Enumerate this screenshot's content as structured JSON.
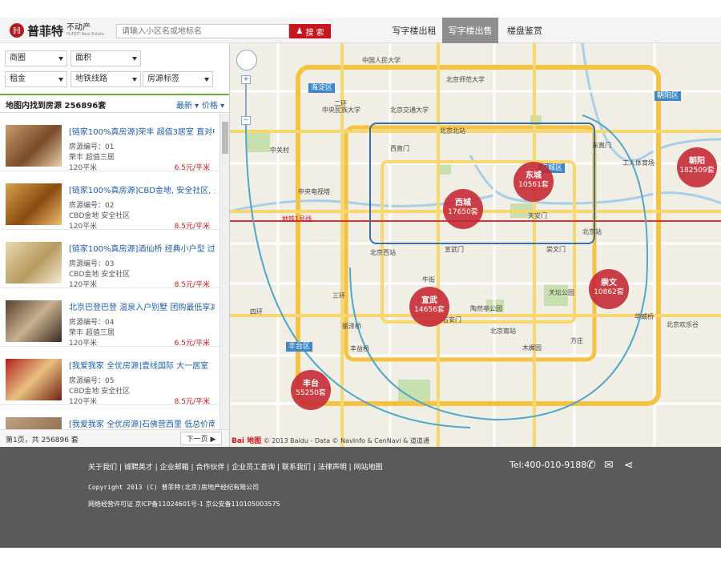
{
  "brand": {
    "name_cn": "普菲特",
    "name_sub": "不动产",
    "name_en": "PUFEIT Real Estate"
  },
  "search": {
    "placeholder": "请输入小区名或地标名",
    "button": "搜 索"
  },
  "nav": {
    "tabs": [
      "写字楼出租",
      "写字楼出售",
      "楼盘鉴赏"
    ],
    "active": "写字楼出售"
  },
  "filters": {
    "row1": [
      "商圈",
      "面积"
    ],
    "row2": [
      "租金",
      "地铁线路",
      "房源标签"
    ]
  },
  "results": {
    "summary": "地图内找到房源 256896套",
    "sort_latest": "最新",
    "sort_price": "价格"
  },
  "listings": [
    {
      "title": "[链家100%真房源]荣丰 超值3居室 直对中",
      "no": "房源编号：01",
      "area_name": "荣丰 超值三居",
      "size": "120平米",
      "price": "6.5元/平米"
    },
    {
      "title": "[链家100%真房源]CBD金地, 安全社区, 无",
      "no": "房源编号：02",
      "area_name": "CBD金地 安全社区",
      "size": "120平米",
      "price": "8.5元/平米"
    },
    {
      "title": "[链家100%真房源]酒仙桥 经典小户型 过",
      "no": "房源编号：03",
      "area_name": "CBD金地 安全社区",
      "size": "120平米",
      "price": "8.5元/平米"
    },
    {
      "title": "北京巴登巴登 温泉入户别墅 团购最低享减",
      "no": "房源编号：04",
      "area_name": "荣丰 超值三居",
      "size": "120平米",
      "price": "6.5元/平米"
    },
    {
      "title": "[我爱我家 全优房源]壹线国际 大一居室",
      "no": "房源编号：05",
      "area_name": "CBD金地 安全社区",
      "size": "120平米",
      "price": "8.5元/平米"
    },
    {
      "title": "[我爱我家 全优房源]石佛营西里 低总价南",
      "no": "",
      "area_name": "",
      "size": "",
      "price": ""
    }
  ],
  "pager": {
    "info": "第1页，共 256896 套",
    "next": "下一页 ▶"
  },
  "map": {
    "districts": [
      "海淀区",
      "东城区",
      "朝阳区",
      "丰台区"
    ],
    "labels": [
      "中国人民大学",
      "北京师范大学",
      "中央民族大学",
      "北京交通大学",
      "北京北站",
      "中关村",
      "中央电视塔",
      "西直门",
      "东直门",
      "工人体育场",
      "天安门",
      "北京站",
      "宣武门",
      "北京西站",
      "崇文门",
      "天坛公园",
      "陶然亭公园",
      "右安门",
      "北京南站",
      "丽泽桥",
      "木樨园",
      "方庄",
      "华威桥",
      "北京欢乐谷",
      "牛街",
      "丰益桥",
      "三环",
      "四环",
      "二环",
      "地铁1号线"
    ],
    "clusters": [
      {
        "name": "西城",
        "count": "17650套"
      },
      {
        "name": "东城",
        "count": "10561套"
      },
      {
        "name": "朝阳",
        "count": "182509套"
      },
      {
        "name": "宣武",
        "count": "14656套"
      },
      {
        "name": "崇文",
        "count": "10862套"
      },
      {
        "name": "丰台",
        "count": "55250套"
      }
    ],
    "attribution_logo": "Bai 地图",
    "attribution": "© 2013 Baidu - Data © NavInfo & CenNavi & 道道通"
  },
  "footer": {
    "links": [
      "关于我们",
      "诚聘英才",
      "企业邮箱",
      "合作伙伴",
      "企业员工查询",
      "联系我们",
      "法律声明",
      "网站地图"
    ],
    "copyright": "Copyright 2013 (C)  普菲特(北京)房地产经纪有限公司",
    "license": "网络经营许可证 京ICP备11024601号-1  京公安备110105003575",
    "tel": "Tel:400-010-9188"
  },
  "colors": {
    "accent": "#c4161c",
    "link": "#1f5fa8",
    "footer_bg": "#5a5a5a",
    "cluster": "#c42632",
    "active_tab": "#8e8e8e"
  }
}
